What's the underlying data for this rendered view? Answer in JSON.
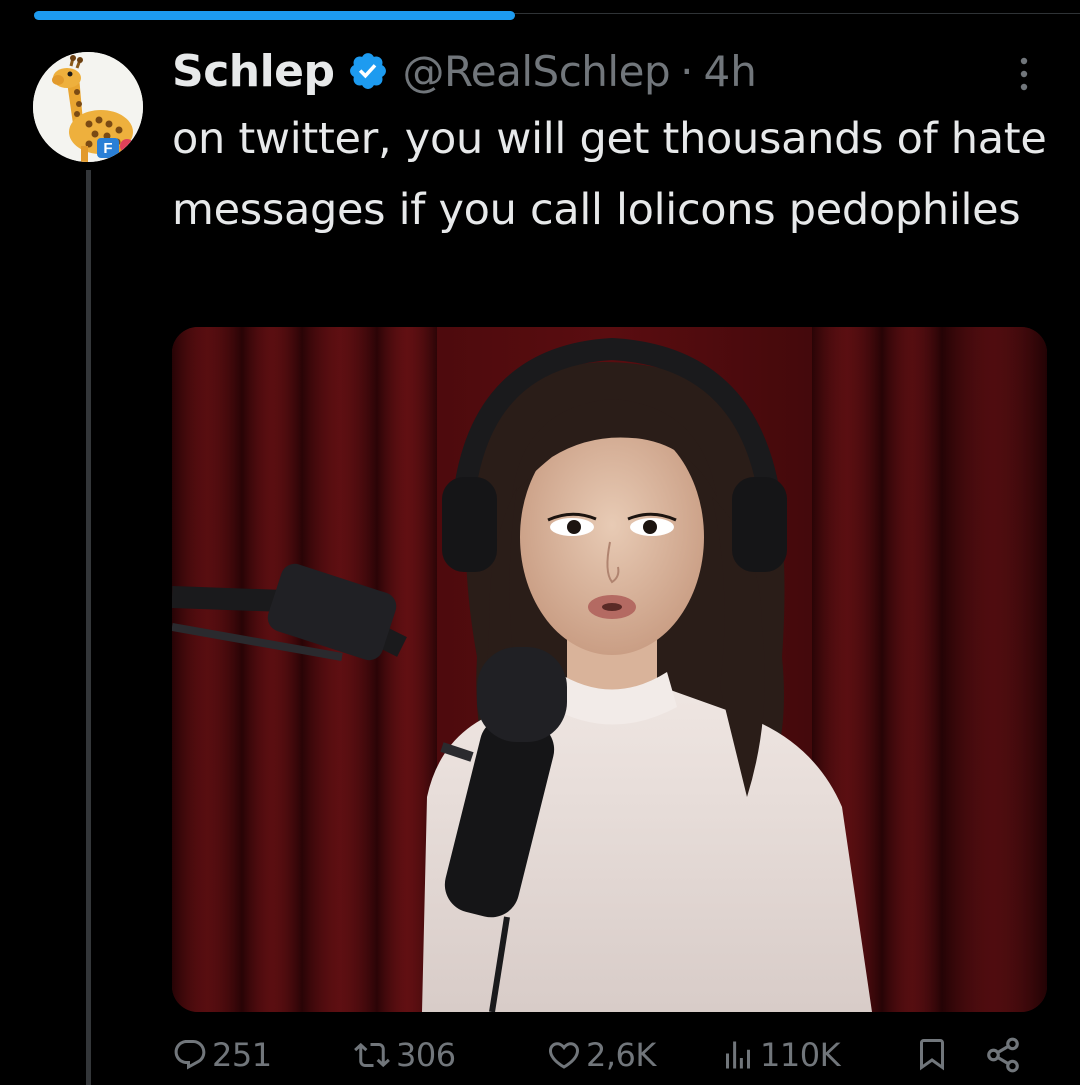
{
  "colors": {
    "background": "#000000",
    "accent": "#1d9bf0",
    "text_primary": "#e7e9ea",
    "text_secondary": "#71767b"
  },
  "progress": {
    "fraction": 0.46
  },
  "tweet": {
    "author": {
      "display_name": "Schlep",
      "handle": "@RealSchlep",
      "verified": true,
      "avatar_icon": "giraffe-avatar",
      "avatar_badge_text": "F"
    },
    "separator": "·",
    "timestamp": "4h",
    "more_icon": "more-vertical-icon",
    "text": "on twitter, you will get thousands of hate messages if you call lolicons pedophiles",
    "media_icon": "photo-woman-headphones-microphone"
  },
  "metrics": {
    "replies": {
      "icon": "reply-icon",
      "count": "251"
    },
    "reposts": {
      "icon": "repost-icon",
      "count": "306"
    },
    "likes": {
      "icon": "like-icon",
      "count": "2,6K"
    },
    "views": {
      "icon": "views-icon",
      "count": "110K"
    },
    "bookmark_icon": "bookmark-icon",
    "share_icon": "share-icon"
  }
}
